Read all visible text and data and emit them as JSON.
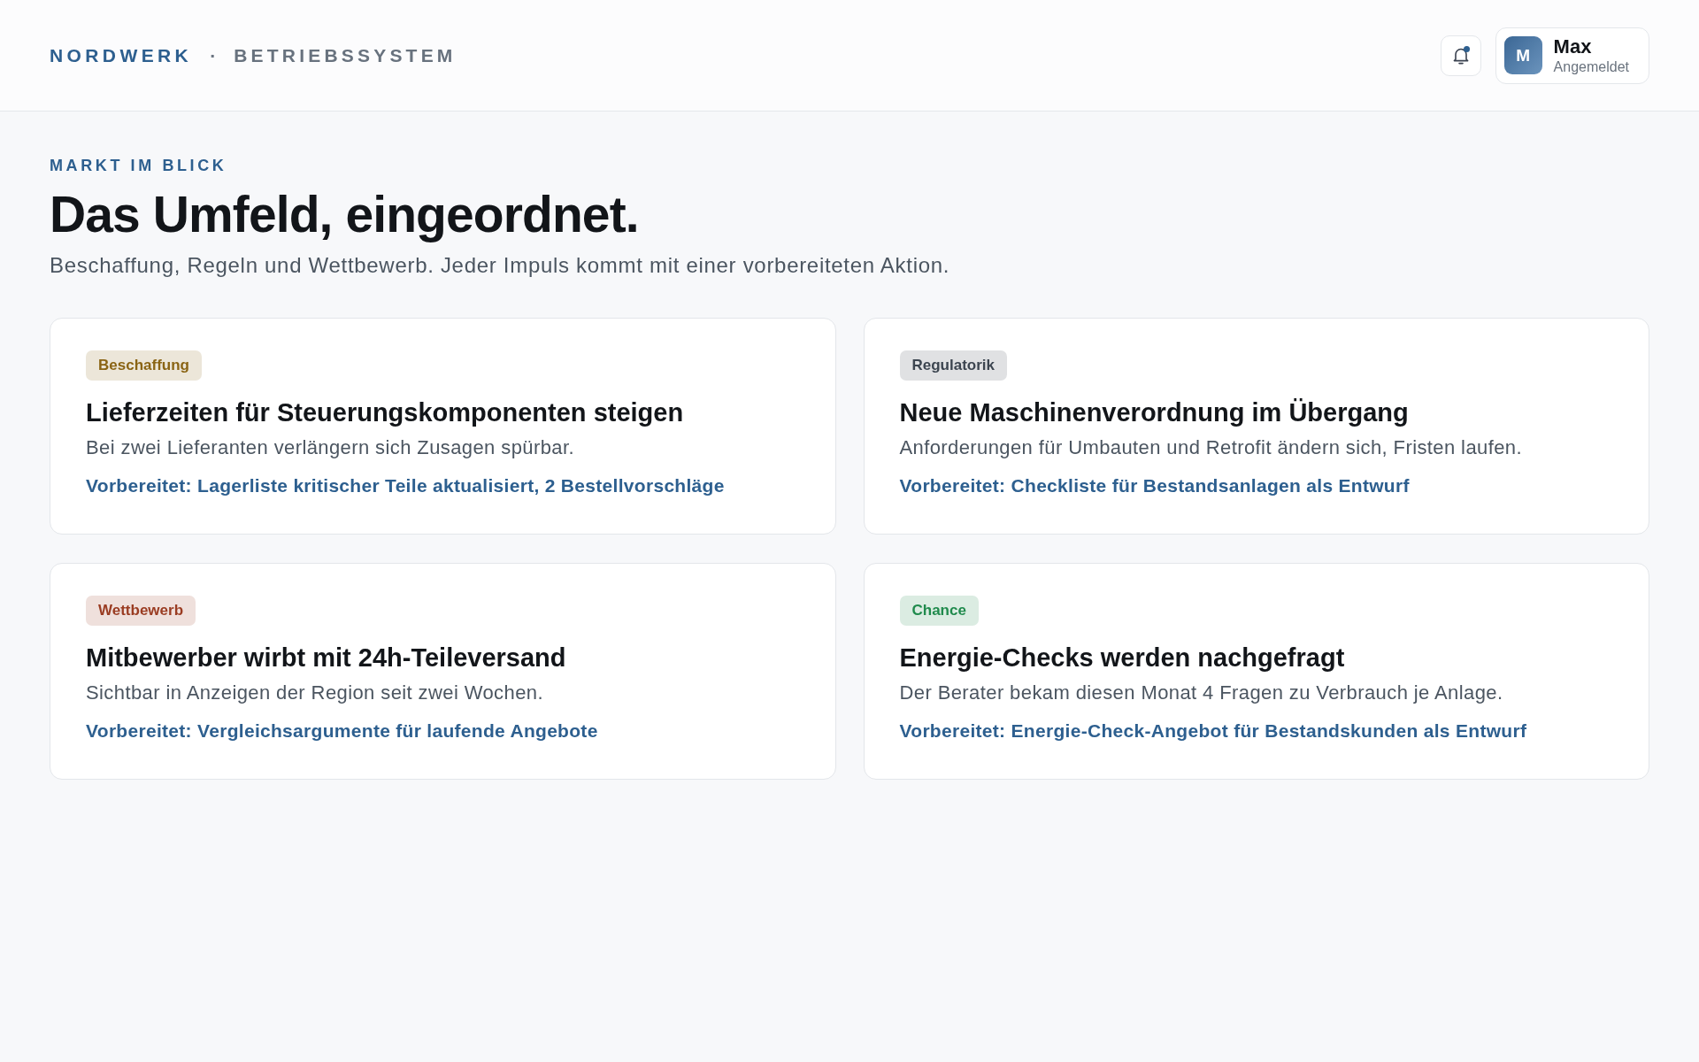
{
  "header": {
    "brand": "NORDWERK",
    "separator": "·",
    "product": "BETRIEBSSYSTEM",
    "notifications": {
      "unread": true
    },
    "user": {
      "initial": "M",
      "name": "Max",
      "status": "Angemeldet"
    }
  },
  "intro": {
    "eyebrow": "MARKT IM BLICK",
    "title": "Das Umfeld, eingeordnet.",
    "subtitle": "Beschaffung, Regeln und Wettbewerb. Jeder Impuls kommt mit einer vorbereiteten Aktion."
  },
  "cards": [
    {
      "tag": {
        "label": "Beschaffung",
        "color": "#8a6414"
      },
      "title": "Lieferzeiten für Steuerungskomponenten steigen",
      "description": "Bei zwei Lieferanten verlängern sich Zusagen spürbar.",
      "action": "Vorbereitet: Lagerliste kritischer Teile aktualisiert, 2 Bestellvorschläge"
    },
    {
      "tag": {
        "label": "Regulatorik",
        "color": "#3c4550"
      },
      "title": "Neue Maschinenverordnung im Übergang",
      "description": "Anforderungen für Umbauten und Retrofit ändern sich, Fristen laufen.",
      "action": "Vorbereitet: Checkliste für Bestandsanlagen als Entwurf"
    },
    {
      "tag": {
        "label": "Wettbewerb",
        "color": "#9a3c22"
      },
      "title": "Mitbewerber wirbt mit 24h-Teileversand",
      "description": "Sichtbar in Anzeigen der Region seit zwei Wochen.",
      "action": "Vorbereitet: Vergleichsargumente für laufende Angebote"
    },
    {
      "tag": {
        "label": "Chance",
        "color": "#1f8a4c"
      },
      "title": "Energie-Checks werden nachgefragt",
      "description": "Der Berater bekam diesen Monat 4 Fragen zu Verbrauch je Anlage.",
      "action": "Vorbereitet: Energie-Check-Angebot für Bestandskunden als Entwurf"
    }
  ]
}
